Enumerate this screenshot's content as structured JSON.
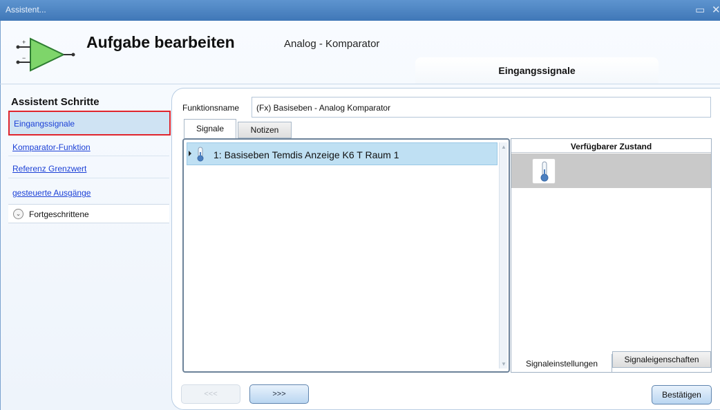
{
  "window": {
    "title": "Assistent..."
  },
  "header": {
    "title": "Aufgabe bearbeiten",
    "subtitle": "Analog - Komparator",
    "tab_label": "Eingangssignale"
  },
  "sidebar": {
    "heading": "Assistent Schritte",
    "items": [
      {
        "label": "Eingangssignale"
      },
      {
        "label": "Komparator-Funktion"
      },
      {
        "label": "Referenz Grenzwert"
      },
      {
        "label": "gesteuerte Ausgänge"
      }
    ],
    "advanced_label": "Fortgeschrittene"
  },
  "function": {
    "label": "Funktionsname",
    "value": "(Fx) Basiseben - Analog Komparator"
  },
  "tabs": {
    "signale": "Signale",
    "notizen": "Notizen"
  },
  "signal_list": [
    {
      "text": "1: Basiseben Temdis Anzeige K6 T Raum 1"
    }
  ],
  "state_panel": {
    "header": "Verfügbarer Zustand"
  },
  "bottom_tabs": {
    "settings": "Signaleinstellungen",
    "properties": "Signaleigenschaften"
  },
  "buttons": {
    "back": "<<<",
    "next": ">>>",
    "confirm": "Bestätigen"
  },
  "colors": {
    "titlebar": "#4a83c4",
    "link": "#1a3fd6",
    "highlight_border": "#e0242c",
    "selection": "#bfe0f3"
  },
  "icons": [
    "comparator-logo-icon",
    "thermometer-icon",
    "chevron-down-icon",
    "restore-icon",
    "close-icon"
  ]
}
